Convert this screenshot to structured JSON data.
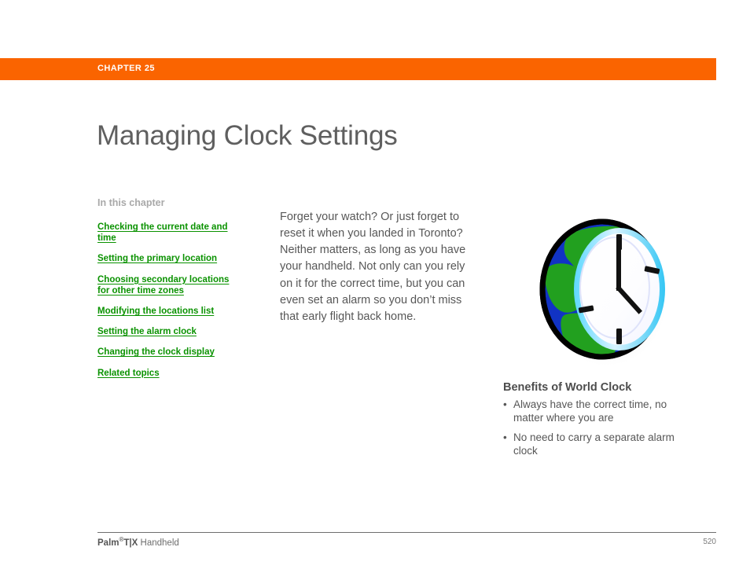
{
  "header": {
    "chapter_label": "CHAPTER 25",
    "accent_color": "#fa6400"
  },
  "title": "Managing Clock Settings",
  "toc": {
    "heading": "In this chapter",
    "link_color": "#0a9200",
    "items": [
      {
        "label": "Checking the current date and time"
      },
      {
        "label": "Setting the primary location"
      },
      {
        "label": "Choosing secondary locations for other time zones"
      },
      {
        "label": "Modifying the locations list"
      },
      {
        "label": "Setting the alarm clock"
      },
      {
        "label": "Changing the clock display"
      },
      {
        "label": "Related topics"
      }
    ]
  },
  "intro": {
    "paragraph": "Forget your watch? Or just forget to reset it when you landed in Toronto? Neither matters, as long as you have your handheld. Not only can you rely on it for the correct time, but you can even set an alarm so you don’t miss that early flight back home."
  },
  "illustration": {
    "icon_name": "world-clock-icon",
    "globe_color": "#1133c4",
    "land_color": "#22a01f",
    "clock_face_color": "#ffffff",
    "outline_color": "#000000"
  },
  "benefits": {
    "title": "Benefits of World Clock",
    "bullet_glyph": "•",
    "items": [
      "Always have the correct time, no matter where you are",
      "No need to carry a separate alarm clock"
    ]
  },
  "footer": {
    "brand": "Palm",
    "registered": "®",
    "model": "T|X",
    "product": "Handheld",
    "page_number": "520"
  }
}
